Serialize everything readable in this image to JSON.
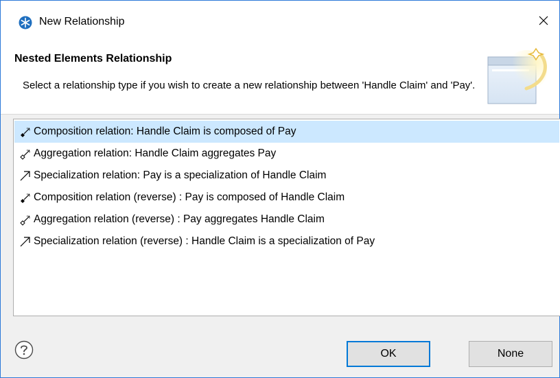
{
  "window": {
    "title": "New Relationship",
    "icon": "snowflake-app-icon",
    "close_icon": "close-icon"
  },
  "banner": {
    "title": "Nested Elements Relationship",
    "description": "Select a relationship type if you wish to create a new relationship between 'Handle Claim' and 'Pay'.",
    "image": "wizard-window-sparkle-graphic"
  },
  "relationships": [
    {
      "icon": "composition-icon",
      "label": "Composition relation: Handle Claim is composed of Pay",
      "selected": true
    },
    {
      "icon": "aggregation-icon",
      "label": "Aggregation relation: Handle Claim aggregates Pay",
      "selected": false
    },
    {
      "icon": "specialization-icon",
      "label": "Specialization relation: Pay is a specialization of Handle Claim",
      "selected": false
    },
    {
      "icon": "composition-icon",
      "label": "Composition relation (reverse) : Pay is composed of Handle Claim",
      "selected": false
    },
    {
      "icon": "aggregation-icon",
      "label": "Aggregation relation (reverse) : Pay aggregates Handle Claim",
      "selected": false
    },
    {
      "icon": "specialization-icon",
      "label": "Specialization relation (reverse) : Handle Claim is a specialization of Pay",
      "selected": false
    }
  ],
  "footer": {
    "help_icon": "help-icon",
    "ok_label": "OK",
    "none_label": "None"
  },
  "colors": {
    "selection": "#cce8ff",
    "accent": "#0078d7",
    "app_icon": "#1f6fbf"
  }
}
